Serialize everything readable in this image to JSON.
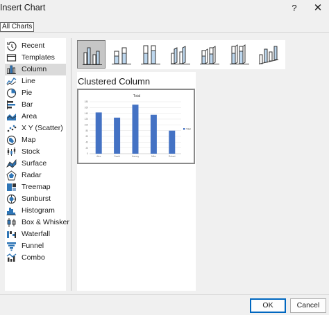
{
  "window": {
    "title": "Insert Chart",
    "help_label": "?",
    "close_label": "✕"
  },
  "tab": {
    "label": "All Charts"
  },
  "sidebar": {
    "selected": "Column",
    "items": [
      {
        "label": "Recent",
        "icon": "recent-icon"
      },
      {
        "label": "Templates",
        "icon": "templates-icon"
      },
      {
        "label": "Column",
        "icon": "column-chart-icon"
      },
      {
        "label": "Line",
        "icon": "line-chart-icon"
      },
      {
        "label": "Pie",
        "icon": "pie-chart-icon"
      },
      {
        "label": "Bar",
        "icon": "bar-chart-icon"
      },
      {
        "label": "Area",
        "icon": "area-chart-icon"
      },
      {
        "label": "X Y (Scatter)",
        "icon": "scatter-chart-icon"
      },
      {
        "label": "Map",
        "icon": "map-chart-icon"
      },
      {
        "label": "Stock",
        "icon": "stock-chart-icon"
      },
      {
        "label": "Surface",
        "icon": "surface-chart-icon"
      },
      {
        "label": "Radar",
        "icon": "radar-chart-icon"
      },
      {
        "label": "Treemap",
        "icon": "treemap-chart-icon"
      },
      {
        "label": "Sunburst",
        "icon": "sunburst-chart-icon"
      },
      {
        "label": "Histogram",
        "icon": "histogram-chart-icon"
      },
      {
        "label": "Box & Whisker",
        "icon": "box-whisker-chart-icon"
      },
      {
        "label": "Waterfall",
        "icon": "waterfall-chart-icon"
      },
      {
        "label": "Funnel",
        "icon": "funnel-chart-icon"
      },
      {
        "label": "Combo",
        "icon": "combo-chart-icon"
      }
    ]
  },
  "subtypes": {
    "selected_index": 0,
    "items": [
      {
        "icon": "clustered-column-icon"
      },
      {
        "icon": "stacked-column-icon"
      },
      {
        "icon": "100-stacked-column-icon"
      },
      {
        "icon": "3d-clustered-column-icon"
      },
      {
        "icon": "3d-stacked-column-icon"
      },
      {
        "icon": "3d-100-stacked-column-icon"
      },
      {
        "icon": "3d-column-icon"
      }
    ]
  },
  "preview": {
    "title": "Clustered Column"
  },
  "colors": {
    "bar": "#4472c4",
    "icon_blue": "#2e75b6",
    "icon_light": "#bdd7ee",
    "selected_bg": "#dadada"
  },
  "chart_data": {
    "type": "bar",
    "title": "Total",
    "categories": [
      "Alex",
      "David",
      "Harvey",
      "Mike",
      "Robert"
    ],
    "series": [
      {
        "name": "Total",
        "values": [
          143,
          125,
          170,
          135,
          80
        ]
      }
    ],
    "ylim": [
      0,
      180
    ],
    "yticks": [
      0,
      20,
      40,
      60,
      80,
      100,
      120,
      140,
      160,
      180
    ],
    "grid": true,
    "legend": "right"
  },
  "buttons": {
    "ok": "OK",
    "cancel": "Cancel"
  }
}
